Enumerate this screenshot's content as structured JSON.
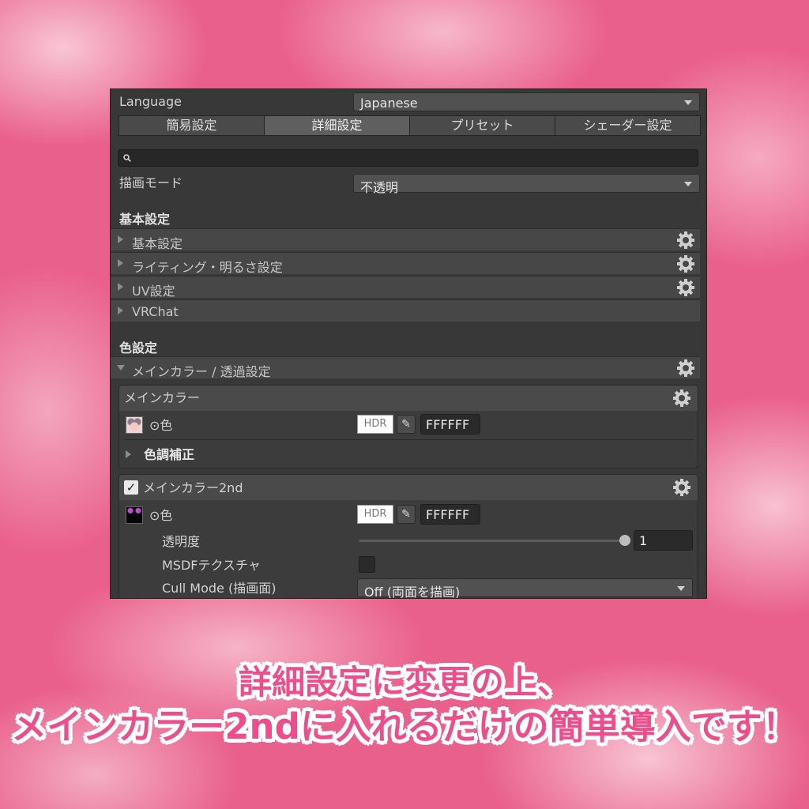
{
  "language": {
    "label": "Language",
    "value": "Japanese"
  },
  "tabs": [
    {
      "label": "簡易設定"
    },
    {
      "label": "詳細設定"
    },
    {
      "label": "プリセット"
    },
    {
      "label": "シェーダー設定"
    }
  ],
  "active_tab": "詳細設定",
  "search": {
    "icon": "search-icon",
    "value": ""
  },
  "render_mode": {
    "label": "描画モード",
    "value": "不透明"
  },
  "basic_section": {
    "title": "基本設定",
    "items": [
      {
        "label": "基本設定",
        "has_gear": true
      },
      {
        "label": "ライティング・明るさ設定",
        "has_gear": true
      },
      {
        "label": "UV設定",
        "has_gear": true
      },
      {
        "label": "VRChat",
        "has_gear": false
      }
    ]
  },
  "color_section": {
    "title": "色設定",
    "foldout": {
      "label": "メインカラー / 透過設定",
      "expanded": true
    }
  },
  "main_color": {
    "title": "メインカラー",
    "color_label": "⊙色",
    "hdr_label": "HDR",
    "hex": "FFFFFF",
    "tone_label": "色調補正"
  },
  "main_color_2nd": {
    "title": "メインカラー2nd",
    "enabled": true,
    "color_label": "⊙色",
    "hdr_label": "HDR",
    "hex": "FFFFFF",
    "opacity_label": "透明度",
    "opacity_value": "1",
    "opacity_fraction": 1.0,
    "msdf_label": "MSDFテクスチャ",
    "msdf_checked": false,
    "cull_label": "Cull Mode (描画面)",
    "cull_value": "Off (両面を描画)"
  },
  "caption": {
    "line1": "詳細設定に変更の上、",
    "line2": "メインカラー2ndに入れるだけの簡単導入です！"
  },
  "colors": {
    "panel_bg": "#383838",
    "caption_text": "#ec4d8b",
    "caption_outline": "#ffffff",
    "background_pink": "#e9608c"
  }
}
